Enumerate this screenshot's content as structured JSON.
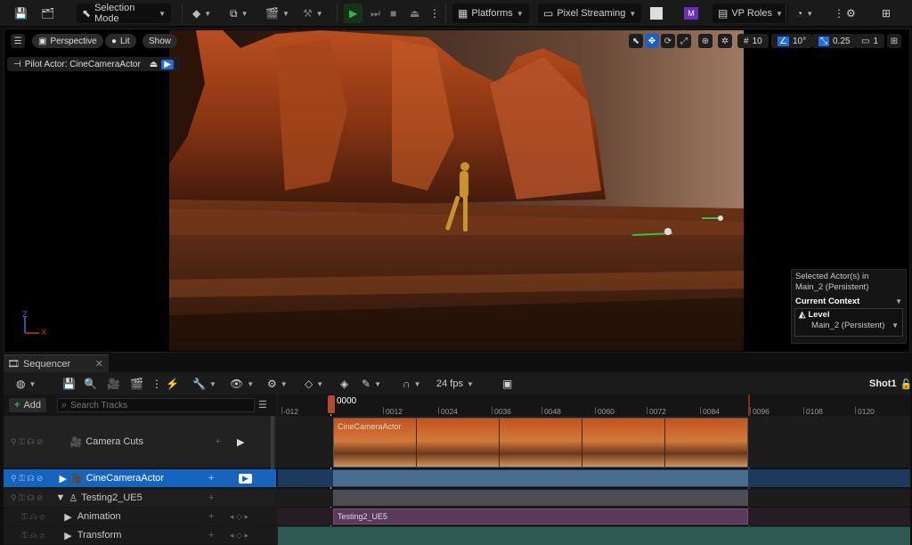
{
  "toolbar": {
    "mode_label": "Selection Mode",
    "platforms_label": "Platforms",
    "pixel_streaming_label": "Pixel Streaming",
    "vp_roles_label": "VP Roles"
  },
  "viewport": {
    "view_label": "Perspective",
    "lit_label": "Lit",
    "show_label": "Show",
    "pilot_label": "Pilot Actor: CineCameraActor",
    "grid_snap": "10",
    "rotation_snap": "10°",
    "scale_snap": "0.25",
    "camera_speed": "1",
    "axis_z": "Z",
    "axis_x": "X"
  },
  "actor_panel": {
    "selected_label": "Selected Actor(s) in",
    "selected_level": "Main_2 (Persistent)",
    "context_label": "Current Context",
    "level_label": "Level",
    "level_value": "Main_2 (Persistent)"
  },
  "sequencer": {
    "tab_label": "Sequencer",
    "fps_label": "24 fps",
    "shot_label": "Shot1",
    "add_label": "Add",
    "search_placeholder": "Search Tracks",
    "current_frame": "0000",
    "ticks": [
      "-012",
      "0012",
      "0024",
      "0036",
      "0048",
      "0060",
      "0072",
      "0084",
      "0096",
      "0108",
      "0120"
    ],
    "tracks": [
      {
        "label": "Camera Cuts"
      },
      {
        "label": "CineCameraActor"
      },
      {
        "label": "Testing2_UE5"
      },
      {
        "label": "Animation"
      },
      {
        "label": "Transform"
      }
    ],
    "camera_section_label": "CineCameraActor",
    "anim_section_label": "Testing2_UE5"
  },
  "colors": {
    "accent": "#1f6fe0",
    "selected_row": "#1565c0",
    "play_green": "#3cb043"
  }
}
